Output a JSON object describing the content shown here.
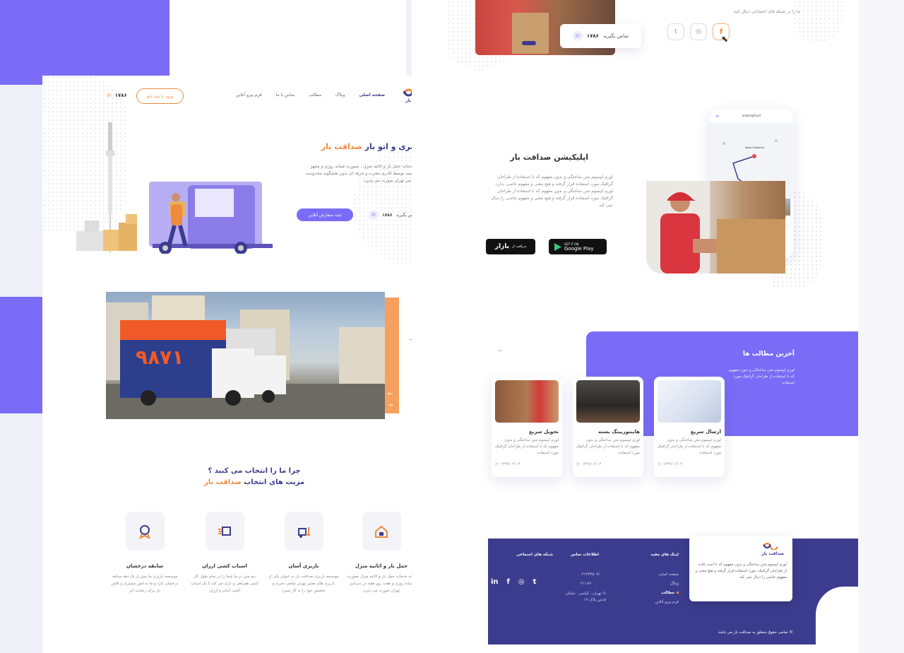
{
  "colors": {
    "accent": "#7a6cf6",
    "orange": "#f08a3c",
    "navy": "#3c3c8f"
  },
  "left": {
    "brand": "صداقت بار",
    "nav": [
      "صفحه اصلی",
      "وبلاگ",
      "مطالب",
      "تماس با ما",
      "فرم پیرو آنلاین"
    ],
    "login_button": "ورود یا ثبت نام",
    "phone": "۱۷۸۶",
    "hero": {
      "title_main": "باربری و اتو بار",
      "title_brand": "صداقت بار",
      "description": "ارائه خدمات حمل بار و اثاثیه منزل ، بصورت شبانه روزی و مجهز روز هستند توسط کادری مجرب و حرفه ای بدون هیچگونه محدودیت در سراسر تهران صورت می پذیرد",
      "cta_button": "ثبت سفارش آنلاین",
      "call_label": "تماس بگیرید",
      "call_number": "۱۷۸۶"
    },
    "slider": {
      "current": "01",
      "items": [
        "02",
        "03"
      ],
      "truck_text": "۹۸۷۱"
    },
    "why": {
      "title": "چرا ما را انتخاب می کنید ؟",
      "subtitle_main": "مزیت های انتخاب",
      "subtitle_brand": "صداقت بار"
    },
    "features": [
      {
        "icon": "house-icon",
        "title": "حمل بار و اثاثیه منزل",
        "text": "ارائه خدمات حمل بار و اثاثیه منزل بصورت شبانه روزی و هفت روز هفته در سراسر تهران صورت می پذیرد"
      },
      {
        "icon": "forklift-icon",
        "title": "باربری آسان",
        "text": "موسسه باربری صداقت بار به عنوان یکی از باربری های معتبر تهران تمامی تجربه و تخصص خود را به کار میبرد"
      },
      {
        "icon": "fast-box-icon",
        "title": "اسباب کشی ارزان",
        "text": "تیم متن در ما شما را در تمام طول کار کشی همراهی و باری می کند تا یک اسباب کشی آسان و ارزان"
      },
      {
        "icon": "award-icon",
        "title": "سابقه درخشان",
        "text": "موسسه باربری ما بیش از یک دهه سابقه درخشان دارد و ما به امور مشتری و تلاش بار برای رضایت ابر"
      }
    ]
  },
  "right": {
    "social_caption": "ما را در شبکه های اجتماعی دنبال کنید",
    "contact_chip_label": "تماس بگیرید",
    "contact_chip_number": "۱۷۸۶",
    "social_icons": [
      "twitter-icon",
      "instagram-icon",
      "facebook-icon"
    ],
    "app": {
      "title": "اپلیکیشن صداقت بار",
      "description": "لورم ایپسوم متن ساختگی و بدون مفهوم که با استفاده از طراحان گرافیک مورد استفاده قرار گرفته و هیچ معنی و مفهوم خاصی ندارد. لورم ایپسوم متن ساختگی و بدون مفهوم که با استفاده از طراحان گرافیک مورد استفاده قرار گرفته و هیچ معنی و مفهوم خاصی را دنبال نمی کند",
      "store_google_small": "GET IT ON",
      "store_google": "Google Play",
      "store_bazaar_small": "دریافت از",
      "store_bazaar": "بازار",
      "phone_header": "webingfood",
      "phone_map_label": "Vokal Sustainat",
      "phone_card1": "Vokal Sustainable",
      "phone_card2": "Vokal Sustainable",
      "phone_tabs": [
        "Home",
        "Reception",
        "Items",
        "Inspiration"
      ]
    },
    "blog": {
      "title": "آخرین مطالب ها",
      "description": "لورم ایپسوم متن ساختگی و بدون مفهوم که با استفاده از طراحان گرافیک مورد استفاده",
      "posts": [
        {
          "title": "ارسال سریع",
          "text": "لورم ایپسوم متن ساختگی و بدون مفهوم که با استفاده از طراحان گرافیک مورد استفاده",
          "date": "۱۳۹۹/۰۲/۰۳"
        },
        {
          "title": "هاینتوربینگ بسته",
          "text": "لورم ایپسوم متن ساختگی و بدون مفهوم که با استفاده از طراحان گرافیک مورد استفاده",
          "date": "۱۳۹۹/۰۲/۰۳"
        },
        {
          "title": "تحویل سریع",
          "text": "لورم ایپسوم متن ساختگی و بدون مفهوم که با استفاده از طراحان گرافیک مورد استفاده",
          "date": "۱۳۹۹/۰۲/۰۳"
        }
      ]
    },
    "footer": {
      "brand": "صداقت بار",
      "about": "لورم ایپسوم متن ساختگی و بدون مفهوم که با است فاده از طراحان گرافیک، مورد استفاده قرار گرفته و هیچ معنی و مفهوم خاصی را دنبال نمی کند",
      "links_title": "لینک های مفید",
      "links": [
        "صفحه اصلی",
        "وبلاگ",
        "مطالب",
        "فرم پیرو آنلاین"
      ],
      "contact_title": "اطلاعات تماس",
      "phone1": "۰۲۱۲۳۴۵",
      "phone2": "۰۲۱۱۸۷۰",
      "address": "تهران ، کیاسر ، خیابان قدس پلاک ۱۷",
      "social_title": "شبکه های اجتماعی",
      "social": [
        "linkedin-icon",
        "facebook-icon",
        "instagram-icon",
        "twitter-icon"
      ],
      "copyright": "تمامی حقوق متعلق به صداقت بار می باشد"
    }
  }
}
